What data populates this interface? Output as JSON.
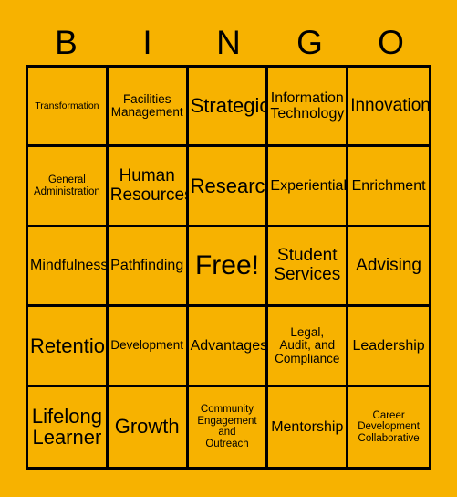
{
  "card": {
    "title": "BINGO",
    "background_color": "#F7B200",
    "border_color": "#000000",
    "text_color": "#000000",
    "header_letters": [
      "B",
      "I",
      "N",
      "G",
      "O"
    ],
    "grid_size": "5x5",
    "free_space_label": "Free!",
    "rows": [
      [
        {
          "label": "Transformation",
          "size": "xxs",
          "free": false
        },
        {
          "label": "Facilities\nManagement",
          "size": "sm",
          "free": false
        },
        {
          "label": "Strategic",
          "size": "xl",
          "free": false
        },
        {
          "label": "Information\nTechnology",
          "size": "md",
          "free": false
        },
        {
          "label": "Innovation",
          "size": "lg",
          "free": false
        }
      ],
      [
        {
          "label": "General\nAdministration",
          "size": "xs",
          "free": false
        },
        {
          "label": "Human\nResources",
          "size": "lg",
          "free": false
        },
        {
          "label": "Research",
          "size": "xl",
          "free": false
        },
        {
          "label": "Experiential",
          "size": "md",
          "free": false
        },
        {
          "label": "Enrichment",
          "size": "md",
          "free": false
        }
      ],
      [
        {
          "label": "Mindfulness",
          "size": "md",
          "free": false
        },
        {
          "label": "Pathfinding",
          "size": "md",
          "free": false
        },
        {
          "label": "Free!",
          "size": "xxl",
          "free": true
        },
        {
          "label": "Student\nServices",
          "size": "lg",
          "free": false
        },
        {
          "label": "Advising",
          "size": "lg",
          "free": false
        }
      ],
      [
        {
          "label": "Retention",
          "size": "xl",
          "free": false
        },
        {
          "label": "Development",
          "size": "sm",
          "free": false
        },
        {
          "label": "Advantages",
          "size": "md",
          "free": false
        },
        {
          "label": "Legal,\nAudit, and\nCompliance",
          "size": "sm",
          "free": false
        },
        {
          "label": "Leadership",
          "size": "md",
          "free": false
        }
      ],
      [
        {
          "label": "Lifelong\nLearner",
          "size": "xl",
          "free": false
        },
        {
          "label": "Growth",
          "size": "xl",
          "free": false
        },
        {
          "label": "Community\nEngagement\nand\nOutreach",
          "size": "xs",
          "free": false
        },
        {
          "label": "Mentorship",
          "size": "md",
          "free": false
        },
        {
          "label": "Career\nDevelopment\nCollaborative",
          "size": "xs",
          "free": false
        }
      ]
    ]
  }
}
